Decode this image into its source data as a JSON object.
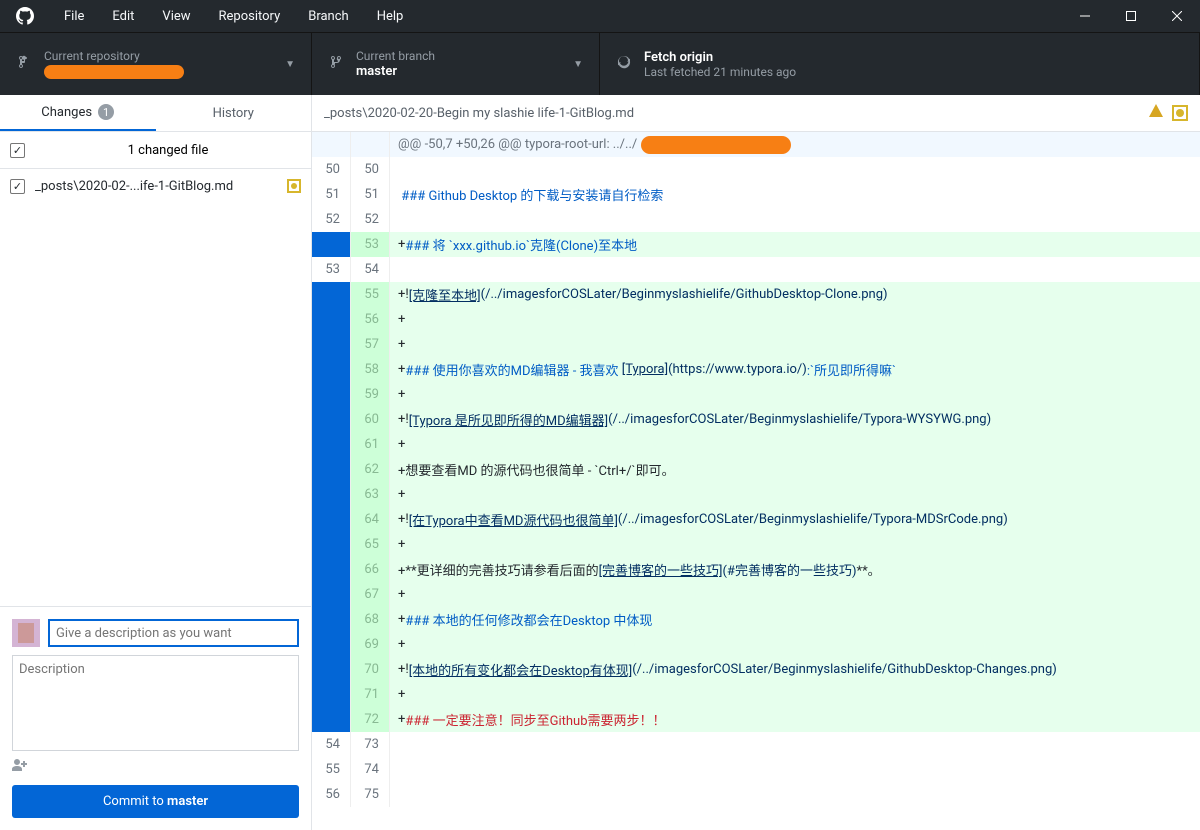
{
  "menu": [
    "File",
    "Edit",
    "View",
    "Repository",
    "Branch",
    "Help"
  ],
  "toolbar": {
    "repo_label": "Current repository",
    "branch_label": "Current branch",
    "branch_value": "master",
    "fetch_label": "Fetch origin",
    "fetch_sub": "Last fetched 21 minutes ago"
  },
  "tabs": {
    "changes": "Changes",
    "changes_count": "1",
    "history": "History"
  },
  "changes": {
    "count_text": "1 changed file",
    "file": "_posts\\2020-02-...ife-1-GitBlog.md"
  },
  "commit": {
    "summary_placeholder": "Give a description as you want",
    "desc_placeholder": "Description",
    "button_prefix": "Commit to ",
    "button_branch": "master"
  },
  "diff": {
    "path": "_posts\\2020-02-20-Begin my slashie life-1-GitBlog.md",
    "hunk_header": "@@ -50,7 +50,26 @@ typora-root-url: ../../",
    "lines": [
      {
        "t": "ctx",
        "o": "50",
        "n": "50",
        "c": ""
      },
      {
        "t": "ctx",
        "o": "51",
        "n": "51",
        "segs": [
          {
            "s": " ### Github Desktop 的下载与安装请自行检索",
            "c": "c-blue"
          }
        ]
      },
      {
        "t": "ctx",
        "o": "52",
        "n": "52",
        "c": ""
      },
      {
        "t": "add",
        "o": "",
        "n": "53",
        "segs": [
          {
            "s": "+",
            "c": "c-gray"
          },
          {
            "s": "### 将 `xxx.github.io`克隆(Clone)至本地",
            "c": "c-blue"
          }
        ]
      },
      {
        "t": "ctx",
        "o": "53",
        "n": "54",
        "c": ""
      },
      {
        "t": "add",
        "o": "",
        "n": "55",
        "segs": [
          {
            "s": "+!",
            "c": "c-gray"
          },
          {
            "s": "[克隆至本地]",
            "c": "c-navy link"
          },
          {
            "s": "(/../imagesforCOSLater/Beginmyslashielife/GithubDesktop-Clone.png)",
            "c": "c-navy"
          }
        ]
      },
      {
        "t": "add",
        "o": "",
        "n": "56",
        "segs": [
          {
            "s": "+",
            "c": "c-gray"
          }
        ]
      },
      {
        "t": "add",
        "o": "",
        "n": "57",
        "segs": [
          {
            "s": "+",
            "c": "c-gray"
          }
        ]
      },
      {
        "t": "add",
        "o": "",
        "n": "58",
        "segs": [
          {
            "s": "+",
            "c": "c-gray"
          },
          {
            "s": "### 使用你喜欢的MD编辑器 - 我喜欢 ",
            "c": "c-blue"
          },
          {
            "s": "[Typora]",
            "c": "c-navy link"
          },
          {
            "s": "(https://www.typora.io/)",
            "c": "c-navy"
          },
          {
            "s": ":`所见即所得嘛`",
            "c": "c-blue"
          }
        ]
      },
      {
        "t": "add",
        "o": "",
        "n": "59",
        "segs": [
          {
            "s": "+",
            "c": "c-gray"
          }
        ]
      },
      {
        "t": "add",
        "o": "",
        "n": "60",
        "segs": [
          {
            "s": "+!",
            "c": "c-gray"
          },
          {
            "s": "[Typora 是所见即所得的MD编辑器]",
            "c": "c-navy link"
          },
          {
            "s": "(/../imagesforCOSLater/Beginmyslashielife/Typora-WYSYWG.png)",
            "c": "c-navy"
          }
        ]
      },
      {
        "t": "add",
        "o": "",
        "n": "61",
        "segs": [
          {
            "s": "+",
            "c": "c-gray"
          }
        ]
      },
      {
        "t": "add",
        "o": "",
        "n": "62",
        "segs": [
          {
            "s": "+想要查看MD 的源代码也很简单 - `Ctrl+/`即可。",
            "c": "c-gray"
          }
        ]
      },
      {
        "t": "add",
        "o": "",
        "n": "63",
        "segs": [
          {
            "s": "+",
            "c": "c-gray"
          }
        ]
      },
      {
        "t": "add",
        "o": "",
        "n": "64",
        "segs": [
          {
            "s": "+!",
            "c": "c-gray"
          },
          {
            "s": "[在Typora中查看MD源代码也很简单]",
            "c": "c-navy link"
          },
          {
            "s": "(/../imagesforCOSLater/Beginmyslashielife/Typora-MDSrCode.png)",
            "c": "c-navy"
          }
        ]
      },
      {
        "t": "add",
        "o": "",
        "n": "65",
        "segs": [
          {
            "s": "+",
            "c": "c-gray"
          }
        ]
      },
      {
        "t": "add",
        "o": "",
        "n": "66",
        "segs": [
          {
            "s": "+**更详细的完善技巧请参看后面的",
            "c": "c-gray"
          },
          {
            "s": "[完善博客的一些技巧]",
            "c": "c-navy link"
          },
          {
            "s": "(#完善博客的一些技巧)",
            "c": "c-navy"
          },
          {
            "s": "**。",
            "c": "c-gray"
          }
        ]
      },
      {
        "t": "add",
        "o": "",
        "n": "67",
        "segs": [
          {
            "s": "+",
            "c": "c-gray"
          }
        ]
      },
      {
        "t": "add",
        "o": "",
        "n": "68",
        "segs": [
          {
            "s": "+",
            "c": "c-gray"
          },
          {
            "s": "### 本地的任何修改都会在Desktop 中体现",
            "c": "c-blue"
          }
        ]
      },
      {
        "t": "add",
        "o": "",
        "n": "69",
        "segs": [
          {
            "s": "+",
            "c": "c-gray"
          }
        ]
      },
      {
        "t": "add",
        "o": "",
        "n": "70",
        "segs": [
          {
            "s": "+!",
            "c": "c-gray"
          },
          {
            "s": "[本地的所有变化都会在Desktop有体现]",
            "c": "c-navy link"
          },
          {
            "s": "(/../imagesforCOSLater/Beginmyslashielife/GithubDesktop-Changes.png)",
            "c": "c-navy"
          }
        ]
      },
      {
        "t": "add",
        "o": "",
        "n": "71",
        "segs": [
          {
            "s": "+",
            "c": "c-gray"
          }
        ]
      },
      {
        "t": "add",
        "o": "",
        "n": "72",
        "segs": [
          {
            "s": "+",
            "c": "c-gray"
          },
          {
            "s": "### 一定要注意！同步至Github需要两步！！",
            "c": "c-red"
          }
        ]
      },
      {
        "t": "ctx",
        "o": "54",
        "n": "73",
        "c": ""
      },
      {
        "t": "ctx",
        "o": "55",
        "n": "74",
        "c": ""
      },
      {
        "t": "ctx",
        "o": "56",
        "n": "75",
        "c": ""
      }
    ]
  }
}
